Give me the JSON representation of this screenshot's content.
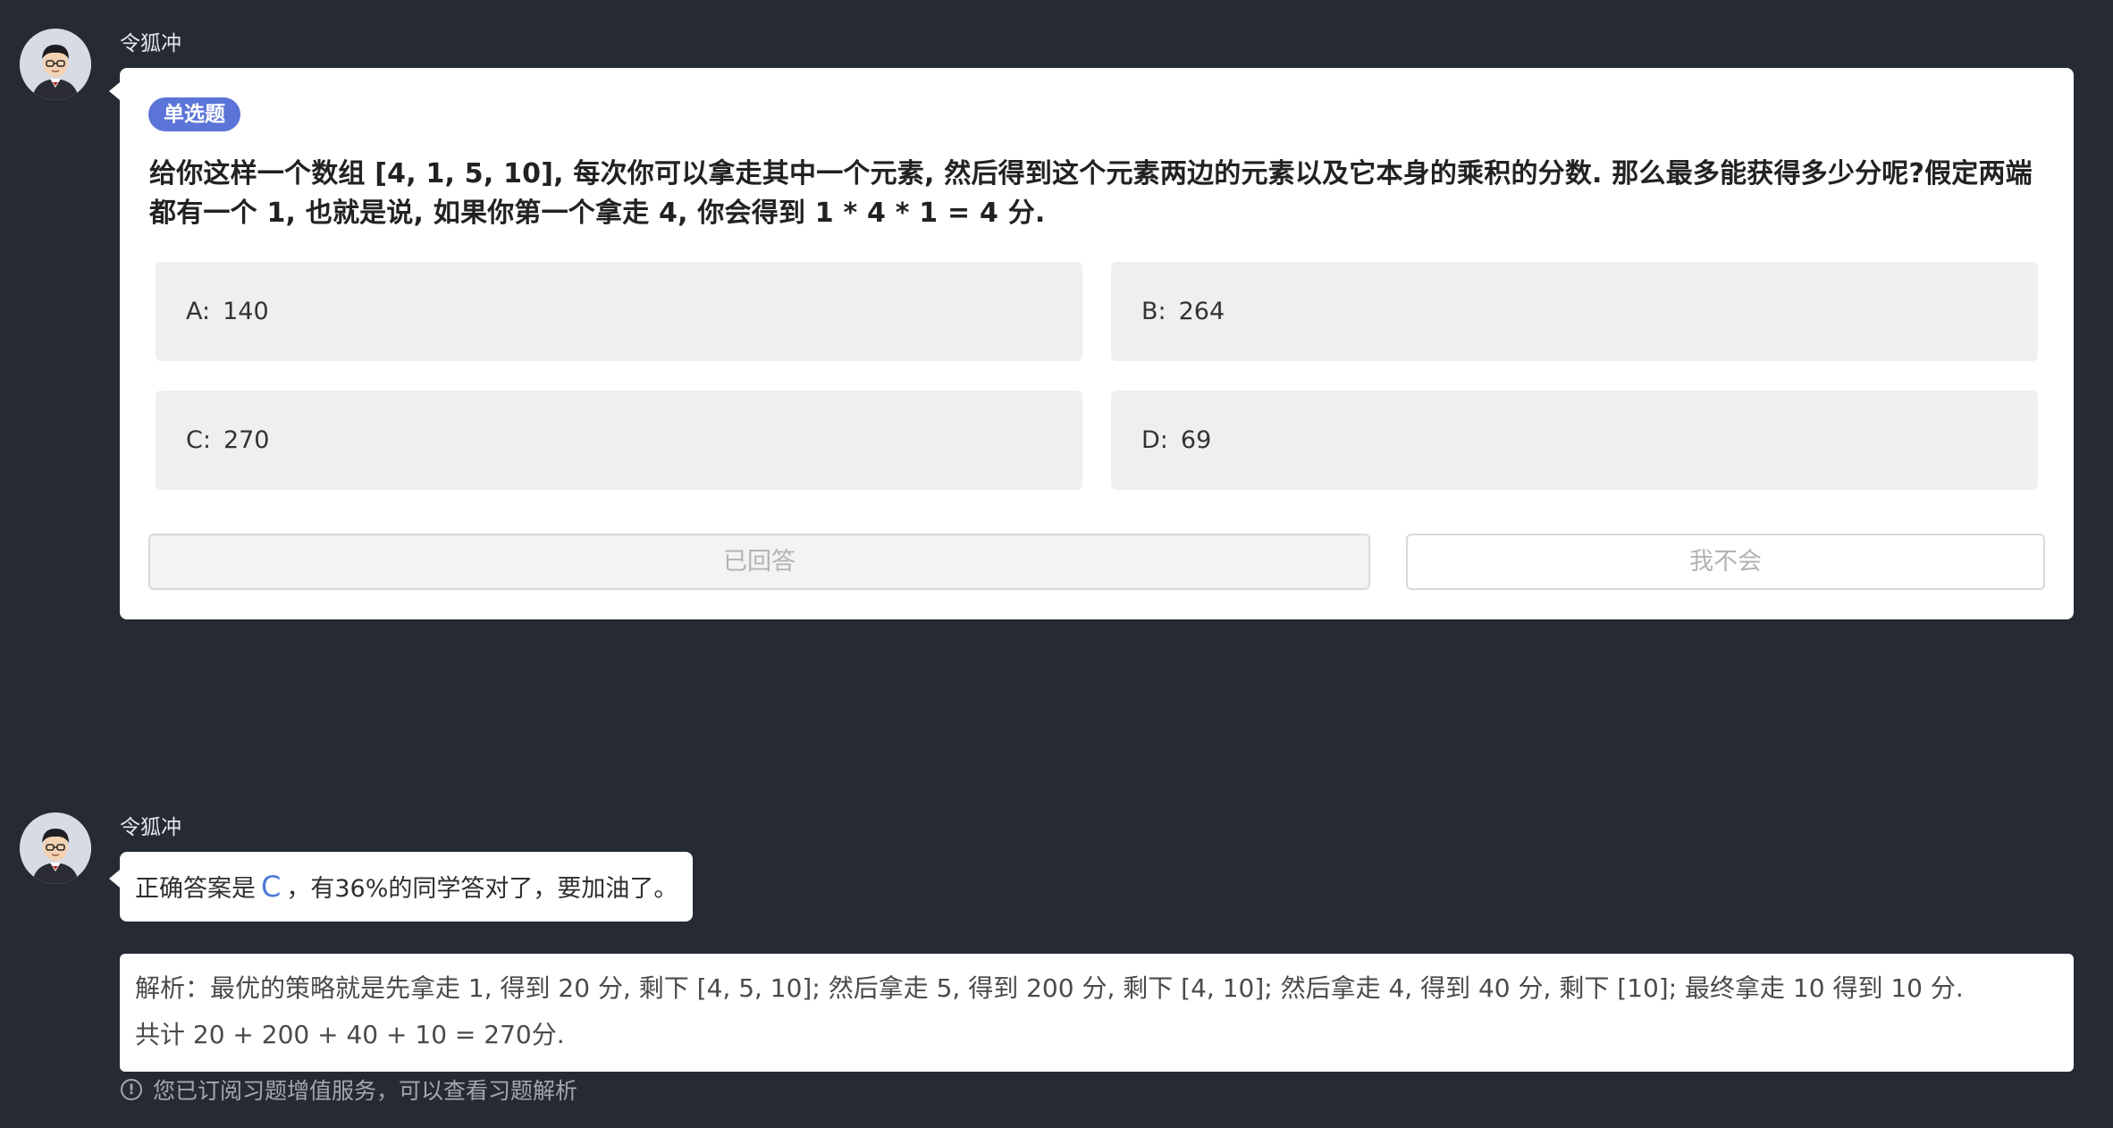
{
  "messages": [
    {
      "sender": "令狐冲"
    },
    {
      "sender": "令狐冲"
    }
  ],
  "quiz": {
    "type_badge": "单选题",
    "question": "给你这样一个数组 [4, 1, 5, 10], 每次你可以拿走其中一个元素, 然后得到这个元素两边的元素以及它本身的乘积的分数. 那么最多能获得多少分呢?假定两端都有一个 1, 也就是说, 如果你第一个拿走 4, 你会得到 1 * 4 * 1 = 4 分.",
    "options": [
      {
        "key": "A:",
        "value": "140"
      },
      {
        "key": "B:",
        "value": "264"
      },
      {
        "key": "C:",
        "value": "270"
      },
      {
        "key": "D:",
        "value": "69"
      }
    ],
    "answered_label": "已回答",
    "dont_know_label": "我不会"
  },
  "answer": {
    "prefix": "正确答案是",
    "letter": "C",
    "suffix": "，有36%的同学答对了，要加油了。"
  },
  "analysis": {
    "line1": "解析：最优的策略就是先拿走 1, 得到 20 分, 剩下 [4, 5, 10]; 然后拿走 5, 得到 200 分, 剩下 [4, 10]; 然后拿走 4, 得到 40 分, 剩下 [10]; 最终拿走 10 得到 10 分.",
    "line2": "共计 20 + 200 + 40 + 10 = 270分."
  },
  "notice": {
    "icon": "info-circle-icon",
    "text": "您已订阅习题增值服务，可以查看习题解析"
  },
  "colors": {
    "background": "#262a33",
    "badge": "#5b74d7",
    "correct_letter": "#4f79d8",
    "option_bg": "#efefef"
  }
}
